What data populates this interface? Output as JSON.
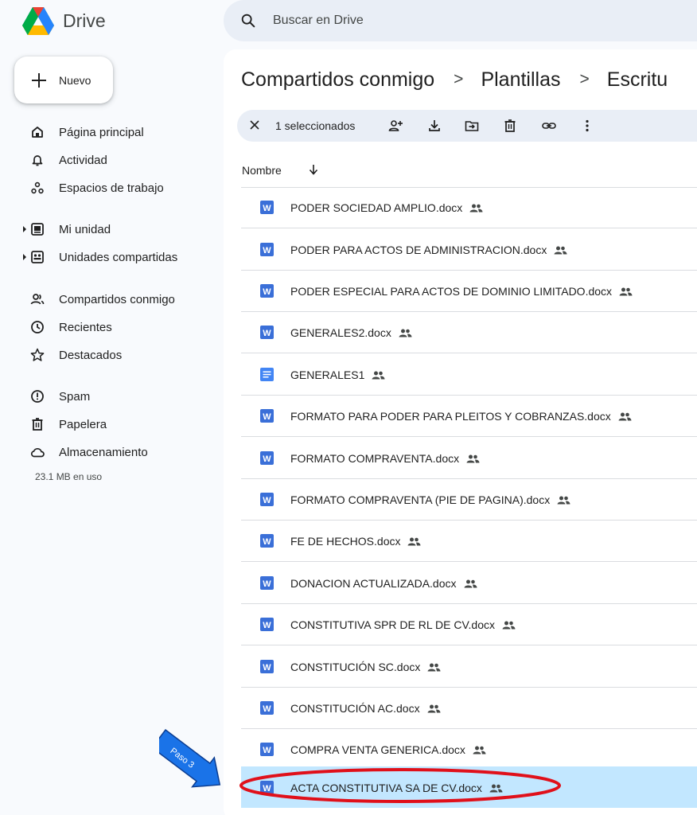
{
  "app": {
    "brand": "Drive",
    "search_placeholder": "Buscar en Drive"
  },
  "sidebar": {
    "new_button": "Nuevo",
    "items": [
      {
        "label": "Página principal",
        "icon": "home-icon"
      },
      {
        "label": "Actividad",
        "icon": "bell-icon"
      },
      {
        "label": "Espacios de trabajo",
        "icon": "workspaces-icon"
      },
      {
        "label": "Mi unidad",
        "icon": "my-drive-icon"
      },
      {
        "label": "Unidades compartidas",
        "icon": "shared-drives-icon"
      },
      {
        "label": "Compartidos conmigo",
        "icon": "shared-with-me-icon"
      },
      {
        "label": "Recientes",
        "icon": "clock-icon"
      },
      {
        "label": "Destacados",
        "icon": "star-icon"
      },
      {
        "label": "Spam",
        "icon": "spam-icon"
      },
      {
        "label": "Papelera",
        "icon": "trash-icon"
      },
      {
        "label": "Almacenamiento",
        "icon": "cloud-icon"
      }
    ],
    "storage_used": "23.1 MB en uso"
  },
  "breadcrumb": {
    "items": [
      "Compartidos conmigo",
      "Plantillas",
      "Escritu"
    ],
    "separator": ">"
  },
  "selection_bar": {
    "count_label": "1 seleccionados",
    "tools": [
      "share-icon",
      "download-icon",
      "move-icon",
      "trash-icon",
      "link-icon",
      "more-icon"
    ]
  },
  "file_list": {
    "column_header": "Nombre",
    "sort": "descending",
    "files": [
      {
        "name": "PODER SOCIEDAD AMPLIO.docx",
        "type": "word"
      },
      {
        "name": "PODER PARA ACTOS DE ADMINISTRACION.docx",
        "type": "word"
      },
      {
        "name": "PODER ESPECIAL PARA ACTOS DE DOMINIO LIMITADO.docx",
        "type": "word"
      },
      {
        "name": "GENERALES2.docx",
        "type": "word"
      },
      {
        "name": "GENERALES1",
        "type": "gdoc"
      },
      {
        "name": "FORMATO PARA PODER PARA PLEITOS Y COBRANZAS.docx",
        "type": "word"
      },
      {
        "name": "FORMATO COMPRAVENTA.docx",
        "type": "word"
      },
      {
        "name": "FORMATO COMPRAVENTA (PIE DE PAGINA).docx",
        "type": "word"
      },
      {
        "name": "FE DE HECHOS.docx",
        "type": "word"
      },
      {
        "name": "DONACION ACTUALIZADA.docx",
        "type": "word"
      },
      {
        "name": "CONSTITUTIVA SPR DE RL DE CV.docx",
        "type": "word"
      },
      {
        "name": "CONSTITUCIÓN SC.docx",
        "type": "word"
      },
      {
        "name": "CONSTITUCIÓN AC.docx",
        "type": "word"
      },
      {
        "name": "COMPRA VENTA GENERICA.docx",
        "type": "word"
      },
      {
        "name": "ACTA CONSTITUTIVA SA DE CV.docx",
        "type": "word",
        "selected": true
      }
    ]
  },
  "annotation": {
    "label": "Paso 3",
    "arrow_color": "#1565c0",
    "ellipse_color": "#e0101a"
  },
  "colors": {
    "background": "#f8fafd",
    "search_bg": "#e9eef6",
    "selected_row": "#c2e7ff",
    "word_icon": "#3a6fd8",
    "gdoc_icon": "#4285f4"
  }
}
